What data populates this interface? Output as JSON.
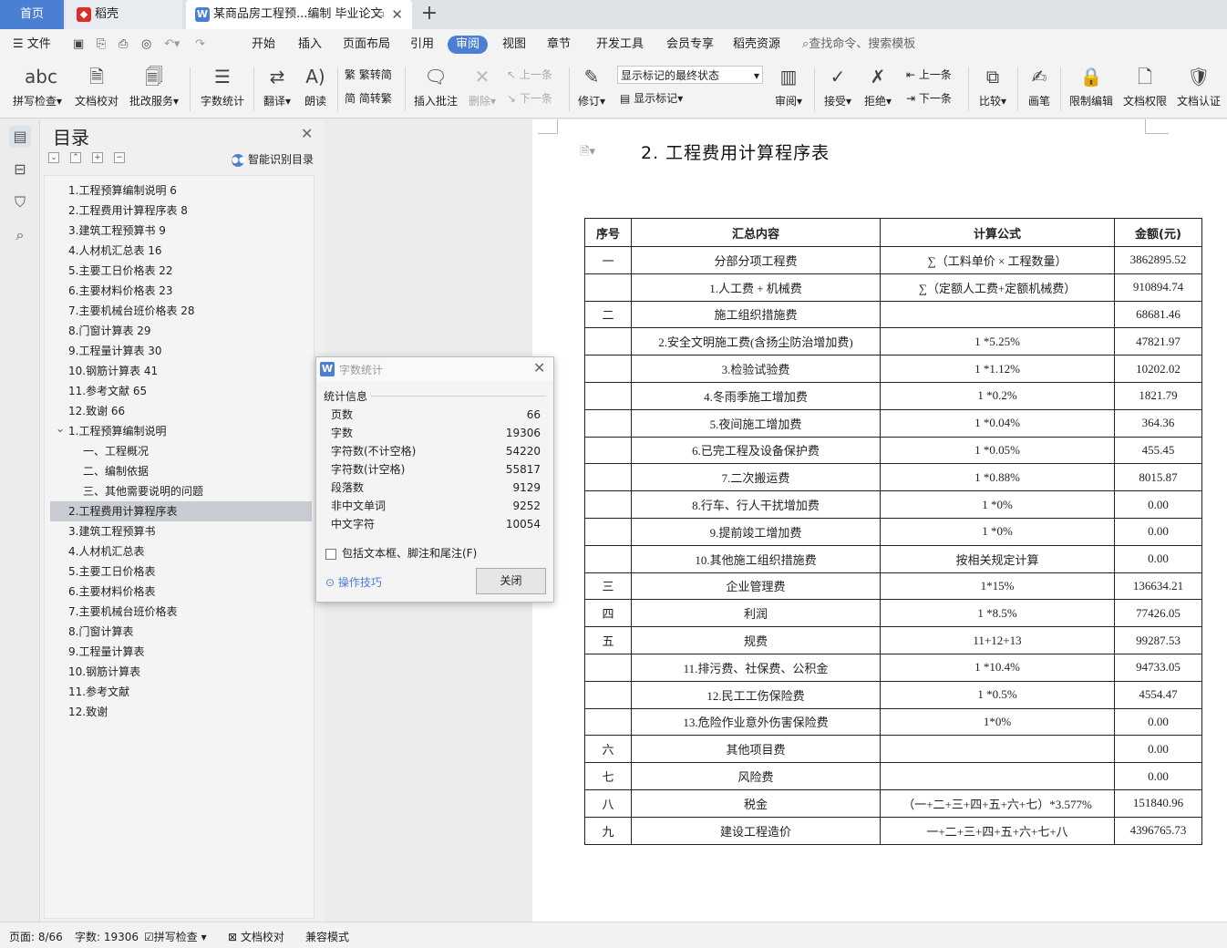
{
  "tabs": {
    "home": "首页",
    "daoke": "稻壳",
    "doc": "某商品房工程预...编制 毕业论文"
  },
  "menu": {
    "file": "文件",
    "items": [
      "开始",
      "插入",
      "页面布局",
      "引用",
      "审阅",
      "视图",
      "章节",
      "开发工具",
      "会员专享",
      "稻壳资源"
    ],
    "active": "审阅",
    "search_placeholder": "查找命令、搜索模板"
  },
  "ribbon": {
    "spellcheck": "拼写检查",
    "doc_proof": "文档校对",
    "batch_service": "批改服务",
    "word_count": "字数统计",
    "translate": "翻译",
    "read_aloud": "朗读",
    "trad_to_simp": "繁转简",
    "simp_to_trad": "简转繁",
    "insert_comment": "插入批注",
    "delete": "删除",
    "prev_comment": "上一条",
    "next_comment": "下一条",
    "track_changes": "修订",
    "markup_state": "显示标记的最终状态",
    "show_markup": "显示标记",
    "review": "审阅",
    "accept": "接受",
    "reject": "拒绝",
    "prev_change": "上一条",
    "next_change": "下一条",
    "compare": "比较",
    "pen": "画笔",
    "restrict_edit": "限制编辑",
    "doc_permission": "文档权限",
    "doc_certify": "文档认证"
  },
  "toc": {
    "title": "目录",
    "smart": "智能识别目录",
    "items": [
      {
        "text": "1.工程预算编制说明 6",
        "indent": 0
      },
      {
        "text": "2.工程费用计算程序表 8",
        "indent": 0
      },
      {
        "text": "3.建筑工程预算书 9",
        "indent": 0
      },
      {
        "text": "4.人材机汇总表 16",
        "indent": 0
      },
      {
        "text": "5.主要工日价格表 22",
        "indent": 0
      },
      {
        "text": "6.主要材料价格表 23",
        "indent": 0
      },
      {
        "text": "7.主要机械台班价格表 28",
        "indent": 0
      },
      {
        "text": "8.门窗计算表 29",
        "indent": 0
      },
      {
        "text": "9.工程量计算表 30",
        "indent": 0
      },
      {
        "text": "10.钢筋计算表 41",
        "indent": 0
      },
      {
        "text": "11.参考文献 65",
        "indent": 0
      },
      {
        "text": "12.致谢 66",
        "indent": 0
      },
      {
        "text": "1.工程预算编制说明",
        "indent": 0,
        "expanded": true
      },
      {
        "text": "一、工程概况",
        "indent": 1
      },
      {
        "text": "二、编制依据",
        "indent": 1
      },
      {
        "text": "三、其他需要说明的问题",
        "indent": 1
      },
      {
        "text": "2.工程费用计算程序表",
        "indent": 0,
        "selected": true
      },
      {
        "text": "3.建筑工程预算书",
        "indent": 0
      },
      {
        "text": "4.人材机汇总表",
        "indent": 0
      },
      {
        "text": "5.主要工日价格表",
        "indent": 0
      },
      {
        "text": "6.主要材料价格表",
        "indent": 0
      },
      {
        "text": "7.主要机械台班价格表",
        "indent": 0
      },
      {
        "text": "8.门窗计算表",
        "indent": 0
      },
      {
        "text": "9.工程量计算表",
        "indent": 0
      },
      {
        "text": "10.钢筋计算表",
        "indent": 0
      },
      {
        "text": "11.参考文献",
        "indent": 0
      },
      {
        "text": "12.致谢",
        "indent": 0
      }
    ]
  },
  "document": {
    "heading": "2. 工程费用计算程序表",
    "table": {
      "headers": [
        "序号",
        "汇总内容",
        "计算公式",
        "金额(元)"
      ],
      "rows": [
        [
          "一",
          "分部分项工程费",
          "∑（工料单价 × 工程数量）",
          "3862895.52"
        ],
        [
          "",
          "1.人工费 + 机械费",
          "∑（定额人工费+定额机械费）",
          "910894.74"
        ],
        [
          "二",
          "施工组织措施费",
          "",
          "68681.46"
        ],
        [
          "",
          "2.安全文明施工费(含扬尘防治增加费)",
          "1 *5.25%",
          "47821.97"
        ],
        [
          "",
          "3.检验试验费",
          "1 *1.12%",
          "10202.02"
        ],
        [
          "",
          "4.冬雨季施工增加费",
          "1 *0.2%",
          "1821.79"
        ],
        [
          "",
          "5.夜间施工增加费",
          "1 *0.04%",
          "364.36"
        ],
        [
          "",
          "6.已完工程及设备保护费",
          "1 *0.05%",
          "455.45"
        ],
        [
          "",
          "7.二次搬运费",
          "1 *0.88%",
          "8015.87"
        ],
        [
          "",
          "8.行车、行人干扰增加费",
          "1 *0%",
          "0.00"
        ],
        [
          "",
          "9.提前竣工增加费",
          "1 *0%",
          "0.00"
        ],
        [
          "",
          "10.其他施工组织措施费",
          "按相关规定计算",
          "0.00"
        ],
        [
          "三",
          "企业管理费",
          "1*15%",
          "136634.21"
        ],
        [
          "四",
          "利润",
          "1 *8.5%",
          "77426.05"
        ],
        [
          "五",
          "规费",
          "11+12+13",
          "99287.53"
        ],
        [
          "",
          "11.排污费、社保费、公积金",
          "1 *10.4%",
          "94733.05"
        ],
        [
          "",
          "12.民工工伤保险费",
          "1 *0.5%",
          "4554.47"
        ],
        [
          "",
          "13.危险作业意外伤害保险费",
          "1*0%",
          "0.00"
        ],
        [
          "六",
          "其他项目费",
          "",
          "0.00"
        ],
        [
          "七",
          "风险费",
          "",
          "0.00"
        ],
        [
          "八",
          "税金",
          "（一+二+三+四+五+六+七）*3.577%",
          "151840.96"
        ],
        [
          "九",
          "建设工程造价",
          "一+二+三+四+五+六+七+八",
          "4396765.73"
        ]
      ]
    }
  },
  "dialog": {
    "title": "字数统计",
    "section": "统计信息",
    "stats": [
      {
        "label": "页数",
        "value": "66"
      },
      {
        "label": "字数",
        "value": "19306"
      },
      {
        "label": "字符数(不计空格)",
        "value": "54220"
      },
      {
        "label": "字符数(计空格)",
        "value": "55817"
      },
      {
        "label": "段落数",
        "value": "9129"
      },
      {
        "label": "非中文单词",
        "value": "9252"
      },
      {
        "label": "中文字符",
        "value": "10054"
      }
    ],
    "include_label": "包括文本框、脚注和尾注(F)",
    "tips": "操作技巧",
    "close_button": "关闭"
  },
  "status": {
    "page": "页面: 8/66",
    "words": "字数: 19306",
    "spellcheck": "拼写检查",
    "proof": "文档校对",
    "compat": "兼容模式"
  },
  "colors": {
    "accent": "#4a7fd4",
    "wps_red": "#d9302c"
  }
}
